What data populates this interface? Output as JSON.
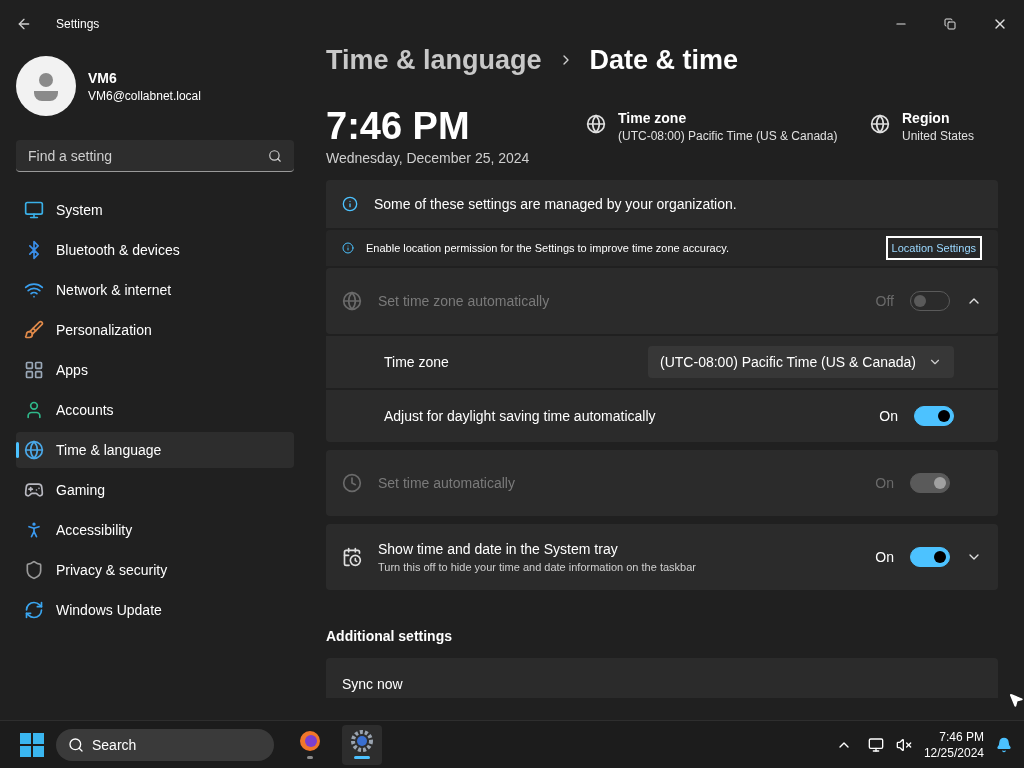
{
  "window": {
    "title": "Settings"
  },
  "user": {
    "name": "VM6",
    "email": "VM6@collabnet.local"
  },
  "search": {
    "placeholder": "Find a setting"
  },
  "sidebar": {
    "items": [
      {
        "label": "System",
        "selected": false
      },
      {
        "label": "Bluetooth & devices",
        "selected": false
      },
      {
        "label": "Network & internet",
        "selected": false
      },
      {
        "label": "Personalization",
        "selected": false
      },
      {
        "label": "Apps",
        "selected": false
      },
      {
        "label": "Accounts",
        "selected": false
      },
      {
        "label": "Time & language",
        "selected": true
      },
      {
        "label": "Gaming",
        "selected": false
      },
      {
        "label": "Accessibility",
        "selected": false
      },
      {
        "label": "Privacy & security",
        "selected": false
      },
      {
        "label": "Windows Update",
        "selected": false
      }
    ]
  },
  "breadcrumb": [
    "Time & language",
    "Date & time"
  ],
  "clock": {
    "time": "7:46 PM",
    "date": "Wednesday, December 25, 2024"
  },
  "summary": [
    {
      "label": "Time zone",
      "value": "(UTC-08:00) Pacific Time (US & Canada)"
    },
    {
      "label": "Region",
      "value": "United States"
    }
  ],
  "notices": [
    {
      "text": "Some of these settings are managed by your organization."
    },
    {
      "text": "Enable location permission for the Settings to improve time zone accuracy.",
      "link": "Location Settings"
    }
  ],
  "settings": [
    {
      "label": "Set time zone automatically",
      "state_label": "Off",
      "on": false,
      "disabled": true,
      "expanded": true,
      "children": [
        {
          "kind": "dropdown",
          "label": "Time zone",
          "value": "(UTC-08:00) Pacific Time (US & Canada)"
        },
        {
          "kind": "toggle",
          "label": "Adjust for daylight saving time automatically",
          "state_label": "On",
          "on": true,
          "disabled": false
        }
      ]
    },
    {
      "label": "Set time automatically",
      "state_label": "On",
      "on": true,
      "disabled": true
    },
    {
      "label": "Show time and date in the System tray",
      "description": "Turn this off to hide your time and date information on the taskbar",
      "state_label": "On",
      "on": true,
      "disabled": false,
      "expanded": false
    }
  ],
  "additional": {
    "heading": "Additional settings",
    "items": [
      {
        "label": "Sync now"
      }
    ]
  },
  "taskbar": {
    "search": "Search",
    "apps": [
      {
        "selected": false
      },
      {
        "selected": true
      }
    ],
    "time": "7:46 PM",
    "date": "12/25/2024"
  }
}
